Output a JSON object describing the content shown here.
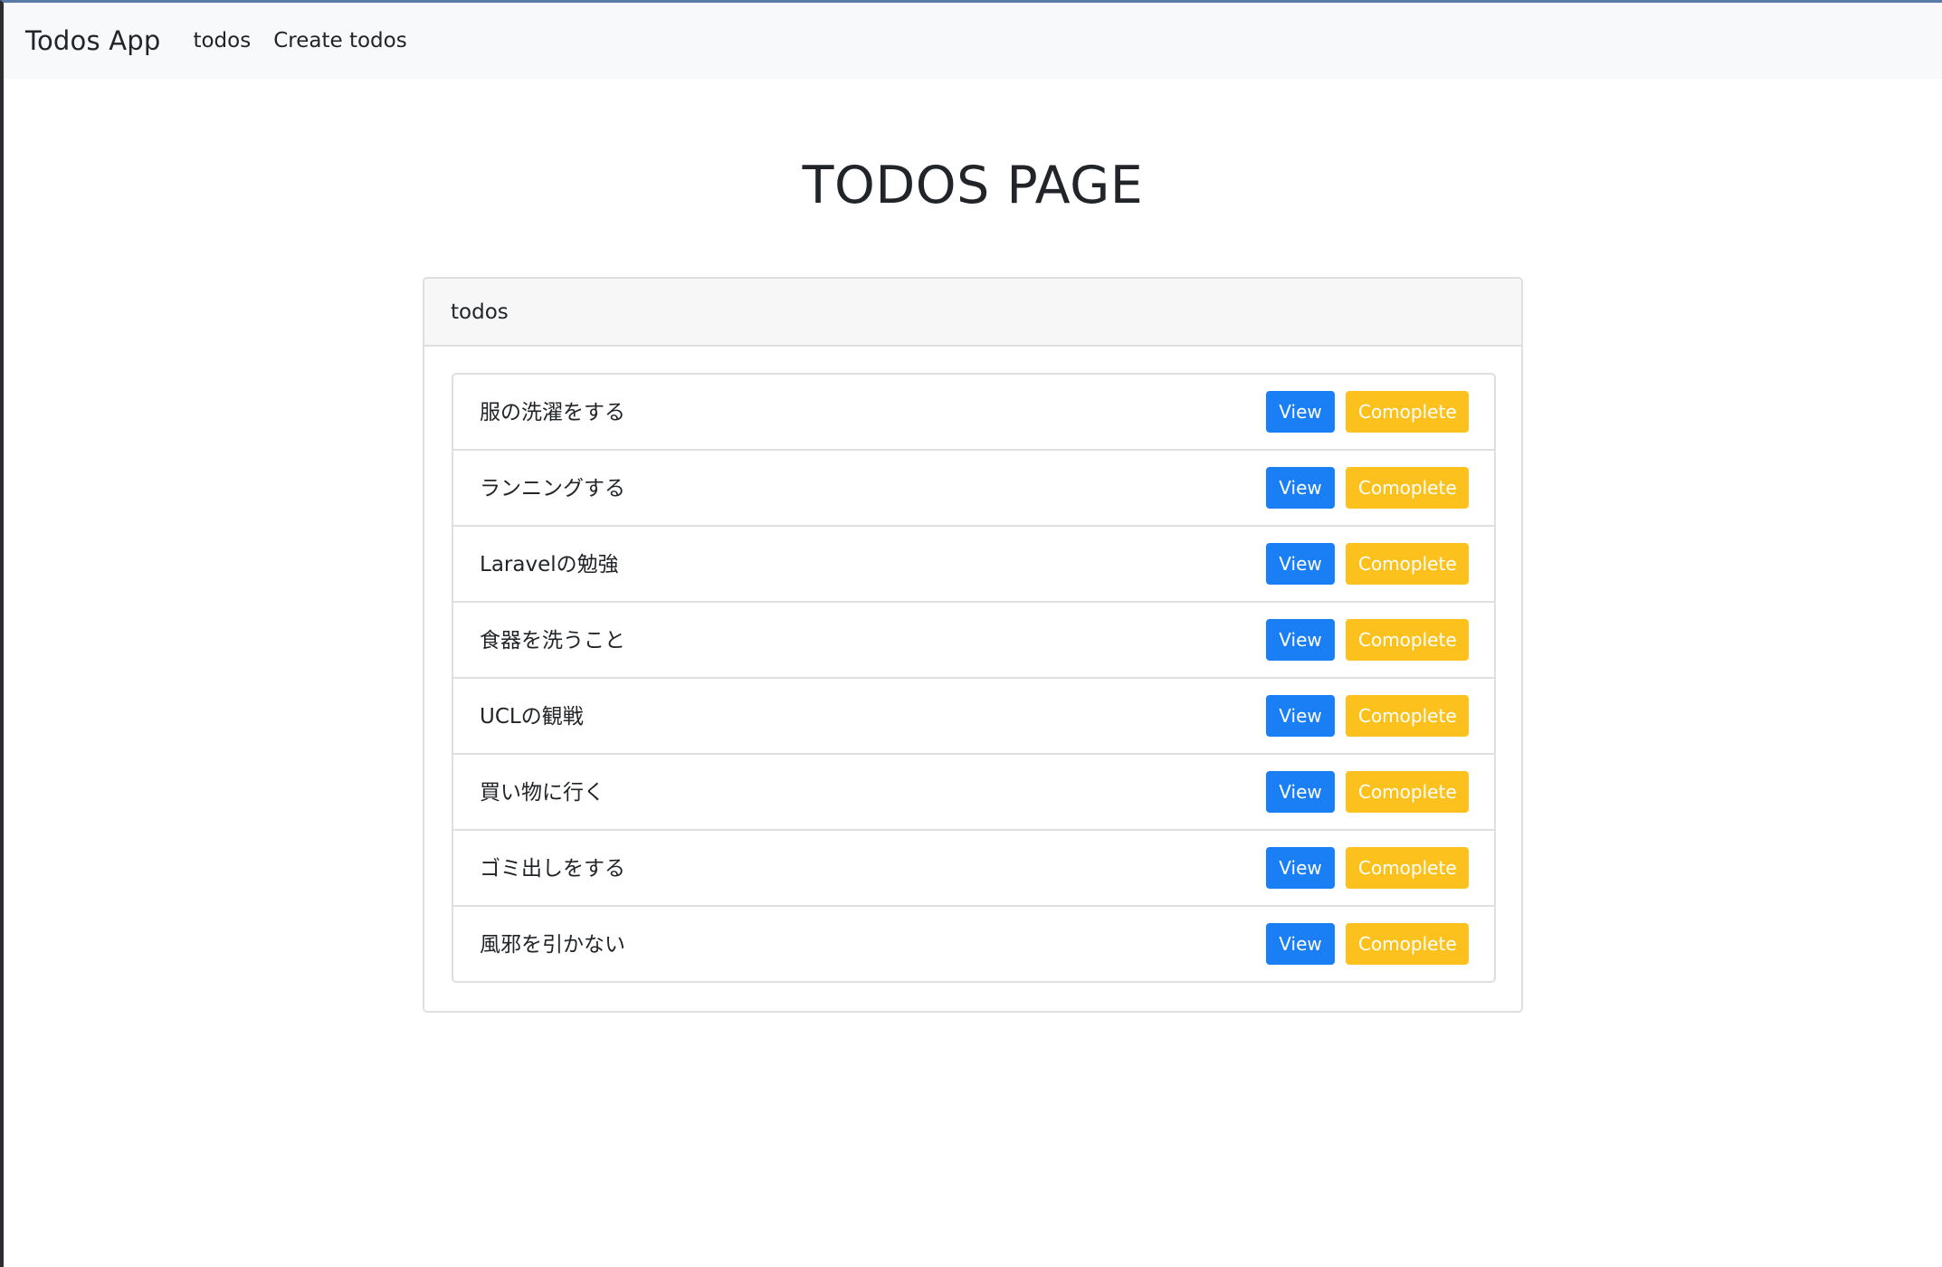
{
  "navbar": {
    "brand": "Todos App",
    "links": [
      "todos",
      "Create todos"
    ]
  },
  "page": {
    "title": "TODOS PAGE"
  },
  "card": {
    "header": "todos",
    "items": [
      {
        "text": "服の洗濯をする",
        "view_label": "View",
        "complete_label": "Comoplete"
      },
      {
        "text": "ランニングする",
        "view_label": "View",
        "complete_label": "Comoplete"
      },
      {
        "text": "Laravelの勉強",
        "view_label": "View",
        "complete_label": "Comoplete"
      },
      {
        "text": "食器を洗うこと",
        "view_label": "View",
        "complete_label": "Comoplete"
      },
      {
        "text": "UCLの観戦",
        "view_label": "View",
        "complete_label": "Comoplete"
      },
      {
        "text": "買い物に行く",
        "view_label": "View",
        "complete_label": "Comoplete"
      },
      {
        "text": "ゴミ出しをする",
        "view_label": "View",
        "complete_label": "Comoplete"
      },
      {
        "text": "風邪を引かない",
        "view_label": "View",
        "complete_label": "Comoplete"
      }
    ]
  },
  "colors": {
    "view_button": "#1a7ff5",
    "complete_button": "#fcc11d",
    "navbar_bg": "#f8f9fa"
  }
}
